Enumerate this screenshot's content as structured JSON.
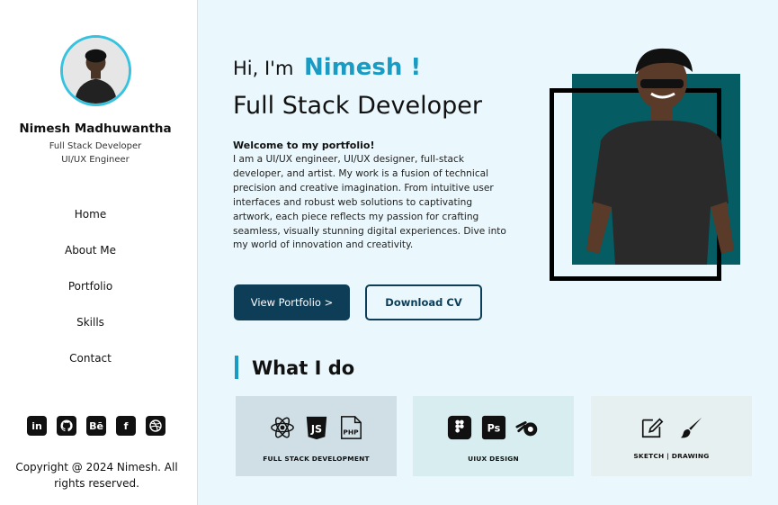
{
  "sidebar": {
    "name": "Nimesh Madhuwantha",
    "role_1": "Full Stack Developer",
    "role_2": "UI/UX Engineer",
    "nav": [
      "Home",
      "About Me",
      "Portfolio",
      "Skills",
      "Contact"
    ],
    "socials": [
      {
        "icon": "linkedin-icon",
        "glyph": "in"
      },
      {
        "icon": "github-icon",
        "glyph": ""
      },
      {
        "icon": "behance-icon",
        "glyph": "Bē"
      },
      {
        "icon": "facebook-icon",
        "glyph": "f"
      },
      {
        "icon": "dribbble-icon",
        "glyph": ""
      }
    ],
    "copyright": "Copyright @ 2024 Nimesh. All rights reserved."
  },
  "hero": {
    "greeting": "Hi, I'm",
    "name": "Nimesh !",
    "headline": "Full Stack Developer",
    "welcome": "Welcome to my portfolio!",
    "bio": "I am a UI/UX engineer, UI/UX designer, full-stack developer, and artist. My work is a fusion of technical precision and creative imagination. From intuitive user interfaces and robust web solutions to captivating artwork, each piece reflects my passion for crafting seamless, visually stunning digital experiences. Dive into my world of innovation and creativity.",
    "view_portfolio": "View Portfolio >",
    "download_cv": "Download CV"
  },
  "what_i_do": {
    "title": "What I do",
    "cards": [
      {
        "label": "FULL STACK DEVELOPMENT",
        "icons": [
          "react-icon",
          "javascript-icon",
          "php-icon"
        ]
      },
      {
        "label": "UIUX DESIGN",
        "icons": [
          "figma-icon",
          "photoshop-icon",
          "blender-icon"
        ]
      },
      {
        "label": "SKETCH |  DRAWING",
        "icons": [
          "pencil-edit-icon",
          "paint-brush-icon"
        ]
      }
    ]
  },
  "colors": {
    "accent": "#1a9bc4",
    "primary_button": "#0d3d57",
    "photo_teal": "#055c62",
    "background": "#eaf8fd"
  }
}
